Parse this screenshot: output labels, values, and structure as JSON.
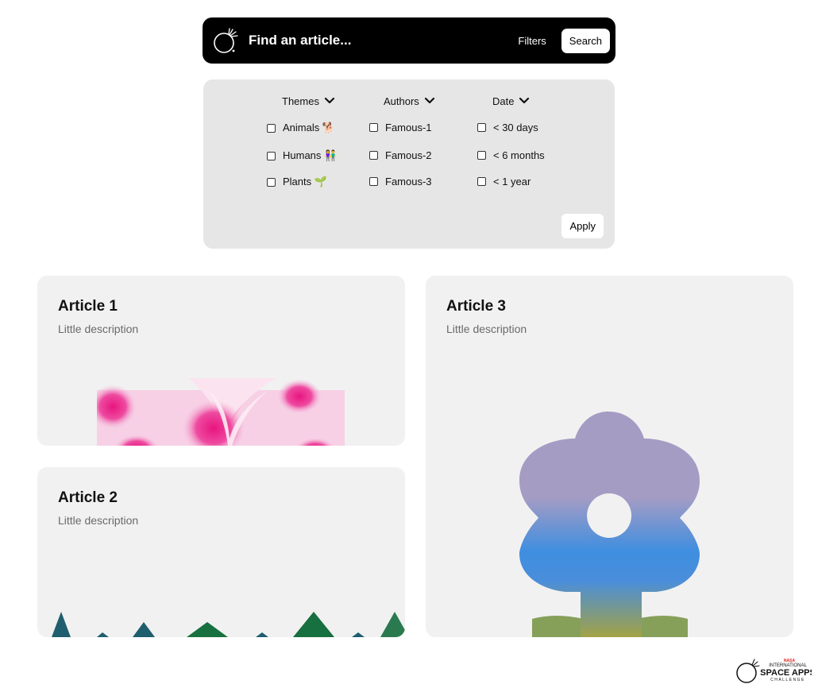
{
  "search": {
    "placeholder": "Find an article...",
    "filters_label": "Filters",
    "search_label": "Search"
  },
  "filters": {
    "groups": [
      {
        "title": "Themes",
        "options": [
          "Animals 🐕",
          "Humans 👫",
          "Plants 🌱"
        ]
      },
      {
        "title": "Authors",
        "options": [
          "Famous-1",
          "Famous-2",
          "Famous-3"
        ]
      },
      {
        "title": "Date",
        "options": [
          "< 30 days",
          "< 6 months",
          "< 1 year"
        ]
      }
    ],
    "apply_label": "Apply"
  },
  "articles": [
    {
      "title": "Article 1",
      "description": "Little description"
    },
    {
      "title": "Article 2",
      "description": "Little description"
    },
    {
      "title": "Article 3",
      "description": "Little description"
    }
  ],
  "brand": {
    "line1": "NASA",
    "line2": "INTERNATIONAL",
    "line3": "SPACE APPS",
    "line4": "CHALLENGE"
  },
  "colors": {
    "searchbar": "#000000",
    "panel": "#e6e6e6",
    "card": "#f1f1f1",
    "accent_pink": "#e8157f",
    "flower_purple": "#a89bc2",
    "flower_blue": "#3f8ee0",
    "flower_olive": "#9aa24a",
    "mountain_teal": "#1f5e6e",
    "mountain_green": "#17703f"
  },
  "icons": {
    "logo": "space-apps-logo-icon",
    "chevron": "chevron-down-icon"
  }
}
